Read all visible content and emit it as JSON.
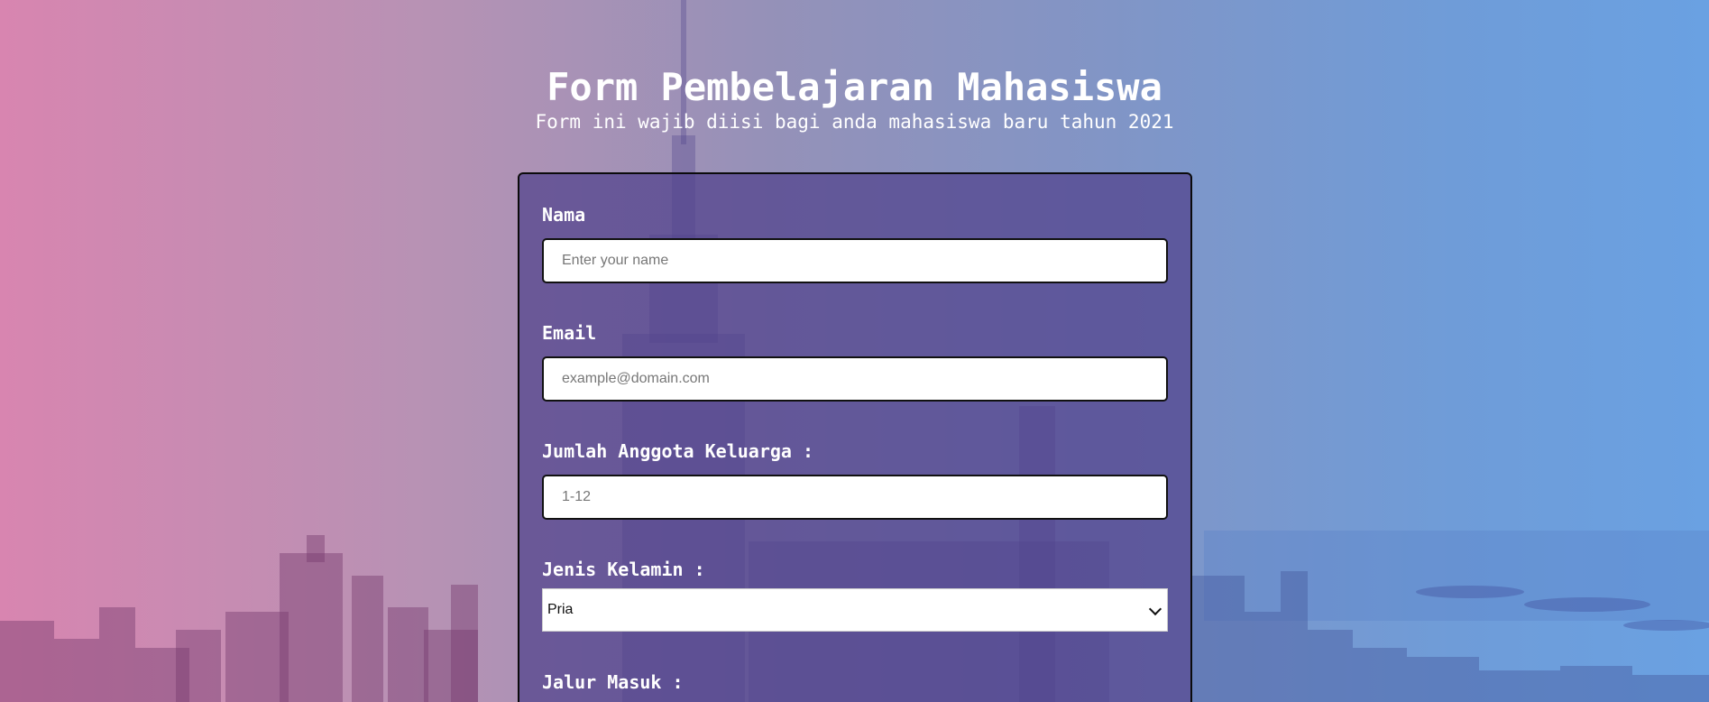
{
  "header": {
    "title": "Form Pembelajaran Mahasiswa",
    "subtitle": "Form ini wajib diisi bagi anda mahasiswa baru tahun 2021"
  },
  "form": {
    "nama": {
      "label": "Nama",
      "placeholder": "Enter your name"
    },
    "email": {
      "label": "Email",
      "placeholder": "example@domain.com"
    },
    "jumlah": {
      "label": "Jumlah Anggota Keluarga :",
      "placeholder": "1-12"
    },
    "jenis_kelamin": {
      "label": "Jenis Kelamin :",
      "selected": "Pria"
    },
    "jalur_masuk": {
      "label": "Jalur Masuk :"
    }
  },
  "colors": {
    "card_bg": "#50418c",
    "gradient_left": "#d885b0",
    "gradient_right": "#6aa1e2"
  }
}
